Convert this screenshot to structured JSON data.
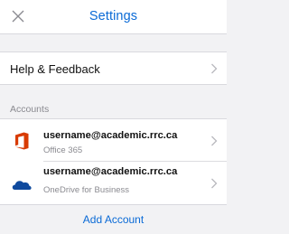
{
  "header": {
    "title": "Settings",
    "close_icon": "close-icon",
    "title_color": "#0a6ad6"
  },
  "help_row": {
    "label": "Help & Feedback",
    "icon": "chevron-right-icon"
  },
  "accounts_section": {
    "label": "Accounts",
    "items": [
      {
        "email": "username@academic.rrc.ca",
        "service": "Office 365",
        "icon": "office-365-icon",
        "icon_color": "#d83b01"
      },
      {
        "email": "username@academic.rrc.ca",
        "service": "OneDrive for Business",
        "icon": "onedrive-icon",
        "icon_color": "#0f4a9e"
      }
    ]
  },
  "add_account": {
    "label": "Add Account"
  }
}
